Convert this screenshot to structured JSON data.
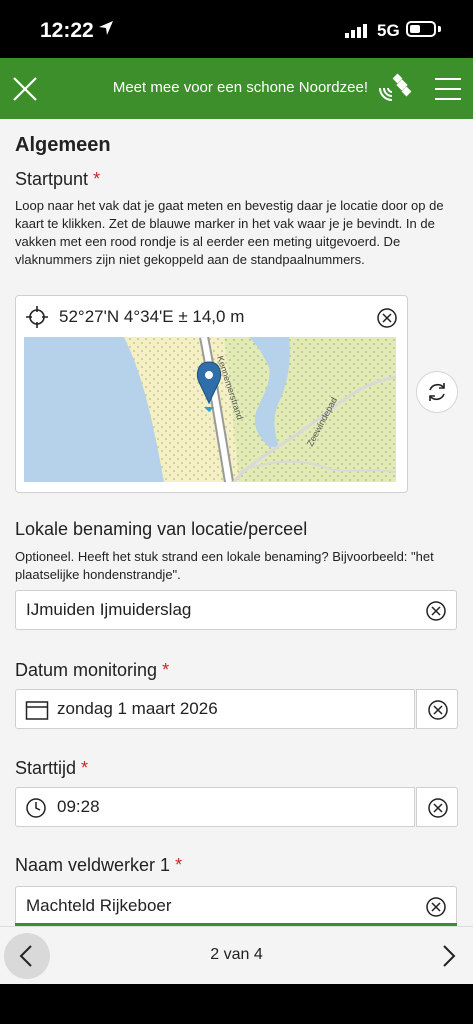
{
  "status_bar": {
    "time": "12:22",
    "network": "5G",
    "battery_level": 0.35
  },
  "header": {
    "title": "Meet mee voor een schone Noordzee!"
  },
  "form": {
    "section_title": "Algemeen",
    "startpoint": {
      "label": "Startpunt",
      "required_mark": "*",
      "help": "Loop naar het vak dat je gaat meten en bevestig daar je locatie door op de kaart te klikken. Zet de blauwe marker in het vak waar je je bevindt. In de vakken met een rood rondje is al eerder een meting uitgevoerd. De vlaknummers zijn niet gekoppeld aan de standpaalnummers.",
      "coordinates": "52°27'N 4°34'E ± 14,0 m",
      "map_labels": {
        "road1": "Kennemerstrand",
        "road2": "Zeewindepad"
      }
    },
    "local_name": {
      "label": "Lokale benaming van locatie/perceel",
      "help": "Optioneel. Heeft het stuk strand een lokale benaming? Bijvoorbeeld: \"het plaatselijke hondenstrandje\".",
      "value": "IJmuiden Ijmuiderslag"
    },
    "date": {
      "label": "Datum monitoring",
      "required_mark": "*",
      "value": "zondag 1 maart 2026"
    },
    "start_time": {
      "label": "Starttijd",
      "required_mark": "*",
      "value": "09:28"
    },
    "fieldworker": {
      "label": "Naam veldwerker 1",
      "required_mark": "*",
      "value": "Machteld Rijkeboer"
    }
  },
  "navigation": {
    "page_indicator": "2 van 4"
  },
  "colors": {
    "brand_green": "#3c8f2b",
    "marker_blue": "#2f6ea8",
    "required_red": "#c62828"
  }
}
